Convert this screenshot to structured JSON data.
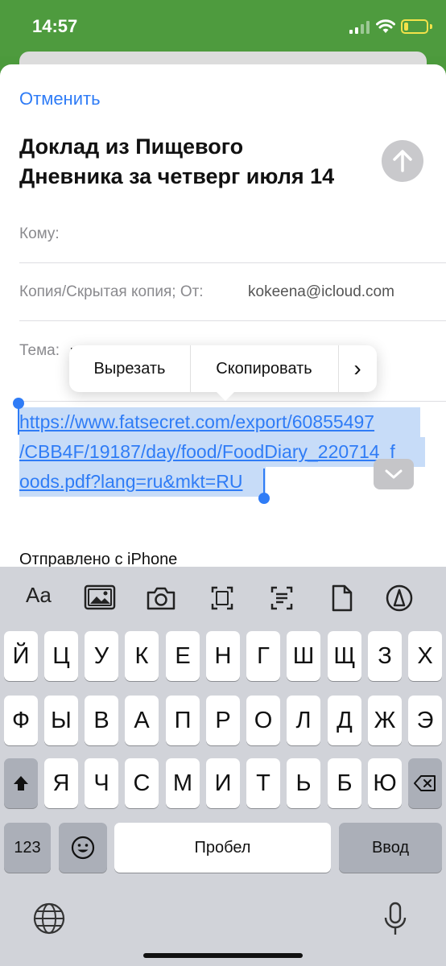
{
  "status_bar": {
    "time": "14:57"
  },
  "compose": {
    "cancel_label": "Отменить",
    "title_line1": "Доклад из Пищевого",
    "title_line2": "Дневника за четверг июля 14",
    "to_label": "Кому:",
    "cc_label": "Копия/Скрытая копия; От:",
    "from_value": "kokeena@icloud.com",
    "subject_label": "Тема:",
    "link_line1": "https://www.fatsecret.com/export/60855497",
    "link_line2": "/CBB4F/19187/day/food/FoodDiary_220714_f",
    "link_line3": "oods.pdf?lang=ru&mkt=RU",
    "signature": "Отправлено с iPhone"
  },
  "context_menu": {
    "cut": "Вырезать",
    "copy": "Скопировать",
    "more": "›"
  },
  "keyboard": {
    "format_label": "Aa",
    "row1": [
      "Й",
      "Ц",
      "У",
      "К",
      "Е",
      "Н",
      "Г",
      "Ш",
      "Щ",
      "З",
      "Х"
    ],
    "row2": [
      "Ф",
      "Ы",
      "В",
      "А",
      "П",
      "Р",
      "О",
      "Л",
      "Д",
      "Ж",
      "Э"
    ],
    "row3": [
      "Я",
      "Ч",
      "С",
      "М",
      "И",
      "Т",
      "Ь",
      "Б",
      "Ю"
    ],
    "numbers_label": "123",
    "space_label": "Пробел",
    "return_label": "Ввод"
  },
  "colors": {
    "accent": "#2f7cf6",
    "status_bar_bg": "#4e9b3e",
    "battery": "#f3e24a",
    "selection": "#c7dcf8"
  }
}
